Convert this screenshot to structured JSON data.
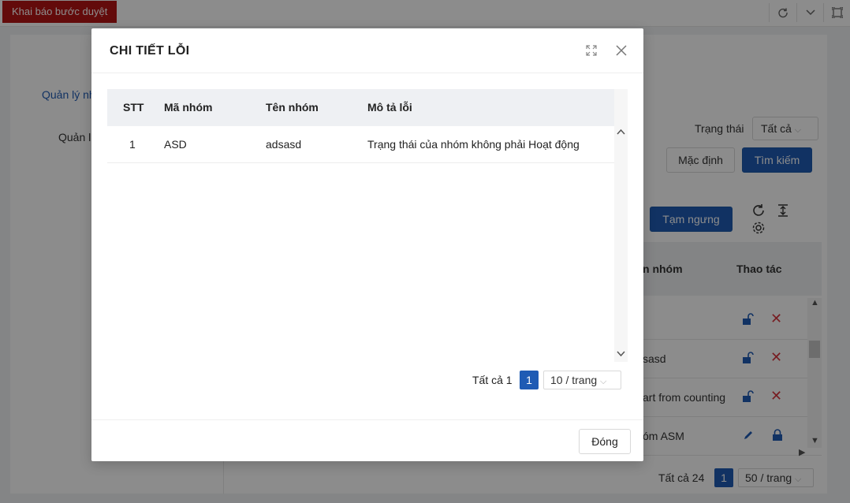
{
  "topbar": {
    "tag_label": "Khai báo bước duyệt"
  },
  "background": {
    "sidebar_item_1": "Quản lý nh",
    "sidebar_item_2": "Quản l",
    "filter_status_label": "Trạng thái",
    "filter_status_value": "Tất cả",
    "default_button": "Mặc định",
    "search_button": "Tìm kiếm",
    "suspend_button": "Tạm ngưng",
    "table_headers": [
      "n nhóm",
      "Thao tác"
    ],
    "rows": [
      "",
      "sasd",
      "art from counting",
      "óm ASM"
    ],
    "total_label": "Tất cả 24",
    "current_page": "1",
    "page_size": "50 / trang"
  },
  "modal": {
    "title": "CHI TIẾT LỖI",
    "columns": [
      "STT",
      "Mã nhóm",
      "Tên nhóm",
      "Mô tả lỗi"
    ],
    "rows": [
      {
        "stt": "1",
        "code": "ASD",
        "name": "adsasd",
        "description": "Trạng thái của nhóm không phải Hoạt động"
      }
    ],
    "total_label": "Tất cả 1",
    "current_page": "1",
    "page_size": "10 / trang",
    "close_button": "Đóng"
  }
}
